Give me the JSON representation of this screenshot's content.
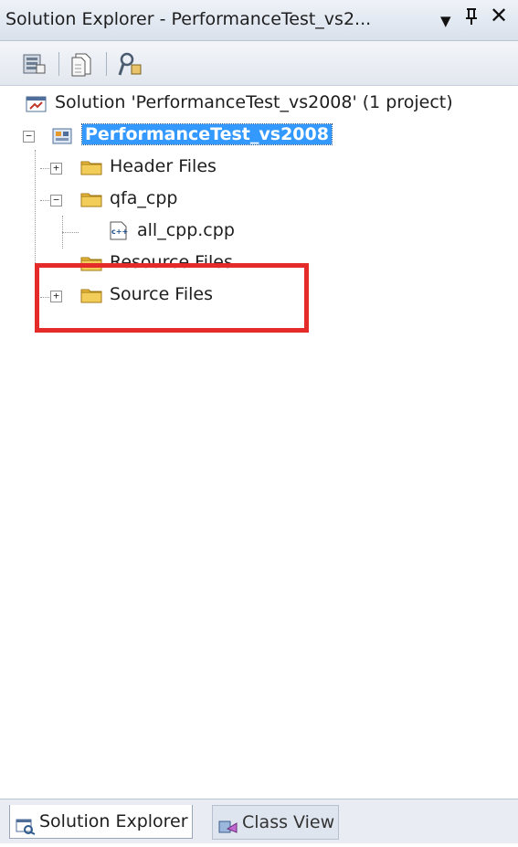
{
  "window": {
    "title": "Solution Explorer - PerformanceTest_vs2...",
    "dropdown_glyph": "▾",
    "pin_glyph": "ᛘ",
    "close_glyph": "✕"
  },
  "toolbar": {
    "buttons": [
      "properties-icon",
      "show-all-files-icon",
      "view-class-diagram-icon"
    ]
  },
  "tree": {
    "solution": "Solution 'PerformanceTest_vs2008' (1 project)",
    "project": "PerformanceTest_vs2008",
    "items": [
      {
        "label": "Header Files",
        "state": "collapsed"
      },
      {
        "label": "qfa_cpp",
        "state": "expanded"
      },
      {
        "label": "all_cpp.cpp",
        "type": "cpp-file"
      },
      {
        "label": "Resource Files",
        "state": "empty"
      },
      {
        "label": "Source Files",
        "state": "collapsed"
      }
    ],
    "highlight_color": "#e52a2a",
    "selection_color": "#3399ff"
  },
  "tabs": [
    {
      "label": "Solution Explorer",
      "active": true
    },
    {
      "label": "Class View",
      "active": false
    }
  ]
}
